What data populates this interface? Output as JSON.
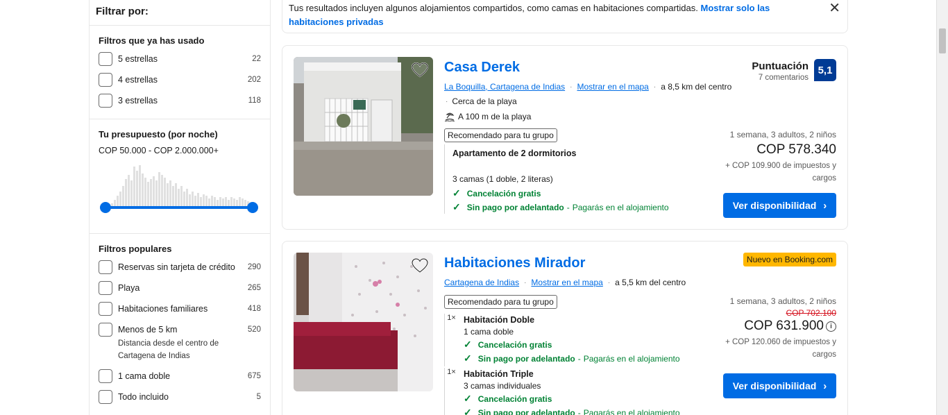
{
  "sidebar": {
    "header": "Filtrar por:",
    "used_filters": {
      "title": "Filtros que ya has usado",
      "items": [
        {
          "label": "5 estrellas",
          "count": "22"
        },
        {
          "label": "4 estrellas",
          "count": "202"
        },
        {
          "label": "3 estrellas",
          "count": "118"
        }
      ]
    },
    "budget": {
      "title": "Tu presupuesto (por noche)",
      "range": "COP 50.000 - COP 2.000.000+",
      "min_fraction": 0,
      "max_fraction": 1
    },
    "popular": {
      "title": "Filtros populares",
      "items": [
        {
          "label": "Reservas sin tarjeta de crédito",
          "count": "290"
        },
        {
          "label": "Playa",
          "count": "265"
        },
        {
          "label": "Habitaciones familiares",
          "count": "418"
        },
        {
          "label": "Menos de 5 km",
          "count": "520",
          "sub": "Distancia desde el centro de Cartagena de Indias"
        },
        {
          "label": "1 cama doble",
          "count": "675"
        },
        {
          "label": "Todo incluido",
          "count": "5"
        }
      ]
    }
  },
  "notice": {
    "text": "Tus resultados incluyen algunos alojamientos compartidos, como camas en habitaciones compartidas.",
    "link": "Mostrar solo las habitaciones privadas"
  },
  "listings": [
    {
      "name": "Casa Derek",
      "location": "La Boquilla, Cartagena de Indias",
      "map_link": "Mostrar en el mapa",
      "distance": "a 8,5 km del centro",
      "near_beach": "Cerca de la playa",
      "beach_distance": "A 100 m de la playa",
      "recommended": "Recomendado para tu grupo",
      "unit_title": "Apartamento de 2 dormitorios",
      "unit_beds": "3 camas (1 doble, 2 literas)",
      "cancel": "Cancelación gratis",
      "no_prepay": "Sin pago por adelantado",
      "no_prepay_note": "Pagarás en el alojamiento",
      "score_word": "Puntuación",
      "score_count": "7 comentarios",
      "score": "5,1",
      "stay": "1 semana, 3 adultos, 2 niños",
      "price": "COP 578.340",
      "taxes": "+ COP 109.900 de impuestos y cargos",
      "cta": "Ver disponibilidad"
    },
    {
      "name": "Habitaciones Mirador",
      "location": "Cartagena de Indias",
      "map_link": "Mostrar en el mapa",
      "distance": "a 5,5 km del centro",
      "badge": "Nuevo en Booking.com",
      "recommended": "Recomendado para tu grupo",
      "rooms": [
        {
          "qty": "1×",
          "title": "Habitación Doble",
          "beds": "1 cama doble",
          "cancel": "Cancelación gratis",
          "no_prepay": "Sin pago por adelantado",
          "no_prepay_note": "Pagarás en el alojamiento"
        },
        {
          "qty": "1×",
          "title": "Habitación Triple",
          "beds": "3 camas individuales",
          "cancel": "Cancelación gratis",
          "no_prepay": "Sin pago por adelantado",
          "no_prepay_note": "Pagarás en el alojamiento"
        }
      ],
      "stay": "1 semana, 3 adultos, 2 niños",
      "old_price": "COP 702.100",
      "price": "COP 631.900",
      "taxes": "+ COP 120.060 de impuestos y cargos",
      "cta": "Ver disponibilidad"
    }
  ],
  "icons": {
    "close": "close-icon",
    "heart": "heart-icon",
    "beach": "beach-icon",
    "check": "check-icon",
    "chevron": "chevron-right-icon",
    "info": "info-icon"
  },
  "colors": {
    "link": "#006ce4",
    "score_bg": "#003b95",
    "green": "#008234",
    "badge": "#ffb700",
    "strike": "#d4111e"
  }
}
